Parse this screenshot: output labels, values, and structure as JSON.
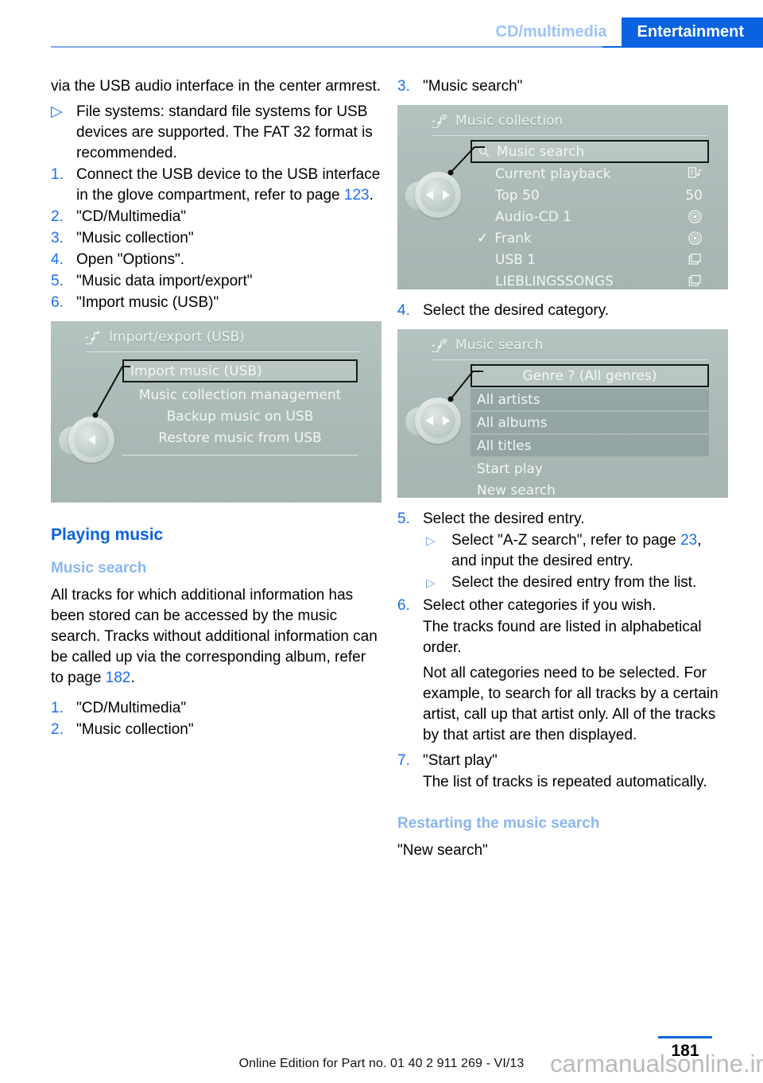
{
  "header": {
    "breadcrumb_secondary": "CD/multimedia",
    "breadcrumb_primary": "Entertainment"
  },
  "left_column": {
    "continuation_text": "via the USB audio interface in the center armrest.",
    "bullet_filesystems": {
      "marker": "▷",
      "text": "File systems: standard file systems for USB devices are supported. The FAT 32 format is recommended."
    },
    "steps": [
      {
        "marker": "1.",
        "text_before": "Connect the USB device to the USB interface in the glove compartment, refer to page ",
        "page_ref": "123",
        "text_after": "."
      },
      {
        "marker": "2.",
        "text": "\"CD/Multimedia\""
      },
      {
        "marker": "3.",
        "text": "\"Music collection\""
      },
      {
        "marker": "4.",
        "text": "Open \"Options\"."
      },
      {
        "marker": "5.",
        "text": "\"Music data import/export\""
      },
      {
        "marker": "6.",
        "text": "\"Import music (USB)\""
      }
    ],
    "screen_import_export": {
      "icon": "music-note-plus-icon",
      "title": "Import/export (USB)",
      "items": [
        {
          "label": "Import music (USB)",
          "selected": true
        },
        {
          "label": "Music collection management",
          "selected": false
        },
        {
          "label": "Backup music on USB",
          "selected": false
        },
        {
          "label": "Restore music from USB",
          "selected": false
        }
      ]
    },
    "section_heading": "Playing music",
    "subsection_heading": "Music search",
    "music_search_intro_before": "All tracks for which additional information has been stored can be accessed by the music search. Tracks without additional information can be called up via the corresponding album, refer to page ",
    "music_search_intro_page": "182",
    "music_search_intro_after": ".",
    "music_search_steps": [
      {
        "marker": "1.",
        "text": "\"CD/Multimedia\""
      },
      {
        "marker": "2.",
        "text": "\"Music collection\""
      }
    ]
  },
  "right_column": {
    "step3": {
      "marker": "3.",
      "text": "\"Music search\""
    },
    "screen_music_collection": {
      "icon": "music-note-list-icon",
      "title": "Music collection",
      "items": [
        {
          "label": "Music search",
          "selected": true,
          "left_icon": "search-icon",
          "right_icon": ""
        },
        {
          "label": "Current playback",
          "selected": false,
          "right_icon": "track-info-icon"
        },
        {
          "label": "Top 50",
          "selected": false,
          "right_icon": "",
          "right_text": "50"
        },
        {
          "label": "Audio-CD 1",
          "selected": false,
          "right_icon": "disc-icon"
        },
        {
          "label": "Frank",
          "selected": false,
          "checked": true,
          "right_icon": "disc-icon"
        },
        {
          "label": "USB 1",
          "selected": false,
          "right_icon": "folder-icon"
        },
        {
          "label": "LIEBLINGSSONGS",
          "selected": false,
          "right_icon": "folder-icon"
        }
      ]
    },
    "step4": {
      "marker": "4.",
      "text": "Select the desired category."
    },
    "screen_music_search": {
      "icon": "music-note-list-icon",
      "title": "Music search",
      "items": [
        {
          "label": "Genre ?  (All genres)",
          "selected": true
        },
        {
          "label": "All artists",
          "highlighted": true
        },
        {
          "label": "All albums",
          "highlighted": true
        },
        {
          "label": "All titles",
          "highlighted": true
        },
        {
          "label": "Start play"
        },
        {
          "label": "New search"
        }
      ]
    },
    "step5": {
      "marker": "5.",
      "text": "Select the desired entry."
    },
    "step5_bullets": [
      {
        "marker": "▷",
        "text_before": "Select \"A-Z search\", refer to page ",
        "page_ref": "23",
        "text_after": ", and input the desired entry."
      },
      {
        "marker": "▷",
        "text": "Select the desired entry from the list."
      }
    ],
    "step6": {
      "marker": "6.",
      "text": "Select other categories if you wish."
    },
    "step6_note1": "The tracks found are listed in alphabetical order.",
    "step6_note2": "Not all categories need to be selected. For example, to search for all tracks by a certain artist, call up that artist only. All of the tracks by that artist are then displayed.",
    "step7": {
      "marker": "7.",
      "text": "\"Start play\""
    },
    "step7_note": "The list of tracks is repeated automatically.",
    "restart_heading": "Restarting the music search",
    "restart_text": "\"New search\""
  },
  "footer": {
    "page_number": "181",
    "edition": "Online Edition for Part no. 01 40 2 911 269 - VI/13",
    "watermark": "carmanualsonline.info"
  },
  "colors": {
    "accent_blue": "#0a62e0",
    "light_blue": "#8ab6ef",
    "screen_bg": "#aab9b6"
  }
}
